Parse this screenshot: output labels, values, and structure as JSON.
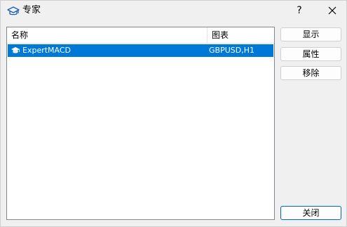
{
  "window": {
    "title": "专家",
    "help_label": "?"
  },
  "list": {
    "columns": [
      "名称",
      "图表"
    ],
    "rows": [
      {
        "name": "ExpertMACD",
        "chart": "GBPUSD,H1",
        "selected": true
      }
    ]
  },
  "buttons": {
    "show": "显示",
    "properties": "属性",
    "remove": "移除",
    "close": "关闭"
  },
  "colors": {
    "selection": "#0078d7",
    "background": "#f0f0f0",
    "accent_border": "#0067c0"
  },
  "icons": {
    "title": "graduation-cap-icon",
    "row": "graduation-cap-icon",
    "close": "close-icon"
  }
}
